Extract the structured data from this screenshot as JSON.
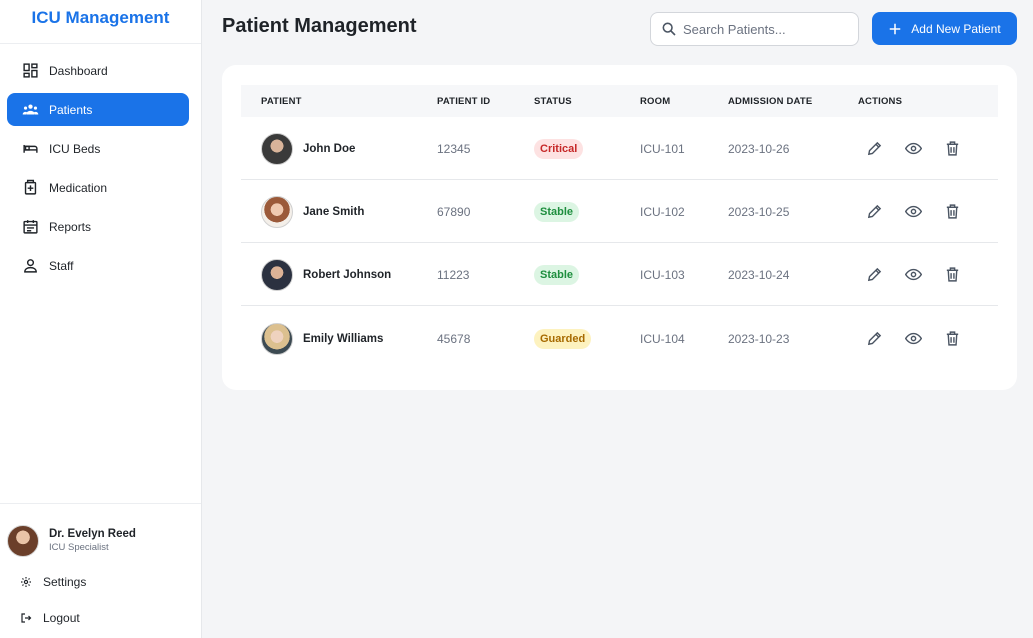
{
  "app": {
    "title": "ICU Management"
  },
  "nav": [
    {
      "label": "Dashboard",
      "icon": "dashboard-icon",
      "active": false
    },
    {
      "label": "Patients",
      "icon": "patients-icon",
      "active": true
    },
    {
      "label": "ICU Beds",
      "icon": "bed-icon",
      "active": false
    },
    {
      "label": "Medication",
      "icon": "medication-icon",
      "active": false
    },
    {
      "label": "Reports",
      "icon": "calendar-icon",
      "active": false
    },
    {
      "label": "Staff",
      "icon": "person-icon",
      "active": false
    }
  ],
  "user": {
    "name": "Dr. Evelyn Reed",
    "role": "ICU Specialist"
  },
  "bottom": {
    "settings": "Settings",
    "logout": "Logout"
  },
  "header": {
    "title": "Patient Management",
    "search_placeholder": "Search Patients...",
    "add_button": "Add New Patient"
  },
  "colors": {
    "accent": "#1a73e8",
    "critical_bg": "#fde2e2",
    "critical_fg": "#c62828",
    "stable_bg": "#dcf5e3",
    "stable_fg": "#1e8e3e",
    "guarded_bg": "#fdf2bf",
    "guarded_fg": "#a76a00"
  },
  "table": {
    "columns": [
      "PATIENT",
      "PATIENT ID",
      "STATUS",
      "ROOM",
      "ADMISSION DATE",
      "ACTIONS"
    ],
    "rows": [
      {
        "name": "John Doe",
        "id": "12345",
        "status": "Critical",
        "status_kind": "critical",
        "room": "ICU-101",
        "date": "2023-10-26"
      },
      {
        "name": "Jane Smith",
        "id": "67890",
        "status": "Stable",
        "status_kind": "stable",
        "room": "ICU-102",
        "date": "2023-10-25"
      },
      {
        "name": "Robert Johnson",
        "id": "11223",
        "status": "Stable",
        "status_kind": "stable",
        "room": "ICU-103",
        "date": "2023-10-24"
      },
      {
        "name": "Emily Williams",
        "id": "45678",
        "status": "Guarded",
        "status_kind": "guarded",
        "room": "ICU-104",
        "date": "2023-10-23"
      }
    ]
  }
}
